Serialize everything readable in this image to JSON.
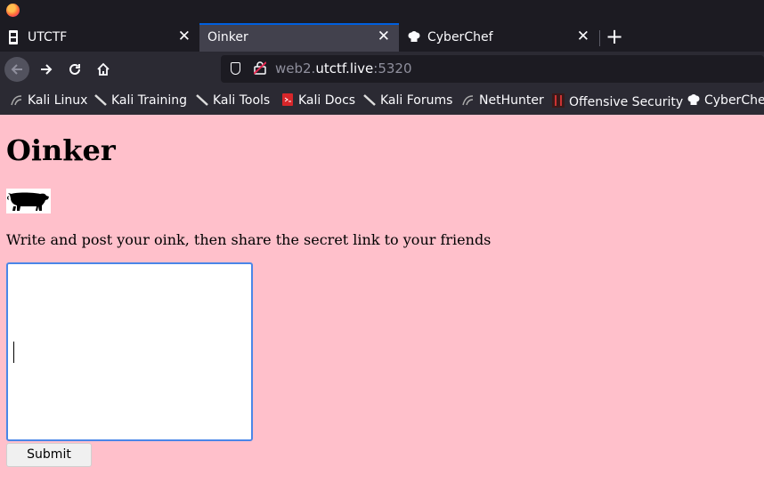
{
  "tabs": [
    {
      "label": "UTCTF",
      "active": false
    },
    {
      "label": "Oinker",
      "active": true
    },
    {
      "label": "CyberChef",
      "active": false
    }
  ],
  "tab_close_glyph": "✕",
  "new_tab_glyph": "+",
  "url": {
    "prefix": "web2.",
    "host": "utctf.live",
    "suffix": ":5320"
  },
  "bookmarks": [
    {
      "label": "Kali Linux",
      "icon": "kali-dragon-icon"
    },
    {
      "label": "Kali Training",
      "icon": "kali-training-icon"
    },
    {
      "label": "Kali Tools",
      "icon": "kali-tools-icon"
    },
    {
      "label": "Kali Docs",
      "icon": "kali-docs-icon"
    },
    {
      "label": "Kali Forums",
      "icon": "kali-forums-icon"
    },
    {
      "label": "NetHunter",
      "icon": "nethunter-icon"
    },
    {
      "label": "Offensive Security",
      "icon": "offsec-icon"
    },
    {
      "label": "CyberChef",
      "icon": "cyberchef-icon"
    }
  ],
  "page": {
    "title": "Oinker",
    "description": "Write and post your oink, then share the secret link to your friends",
    "textarea_value": "",
    "submit_label": "Submit"
  },
  "colors": {
    "page_bg": "#ffc0cb",
    "focus": "#4a86e8",
    "active_tab_accent": "#0060df"
  }
}
